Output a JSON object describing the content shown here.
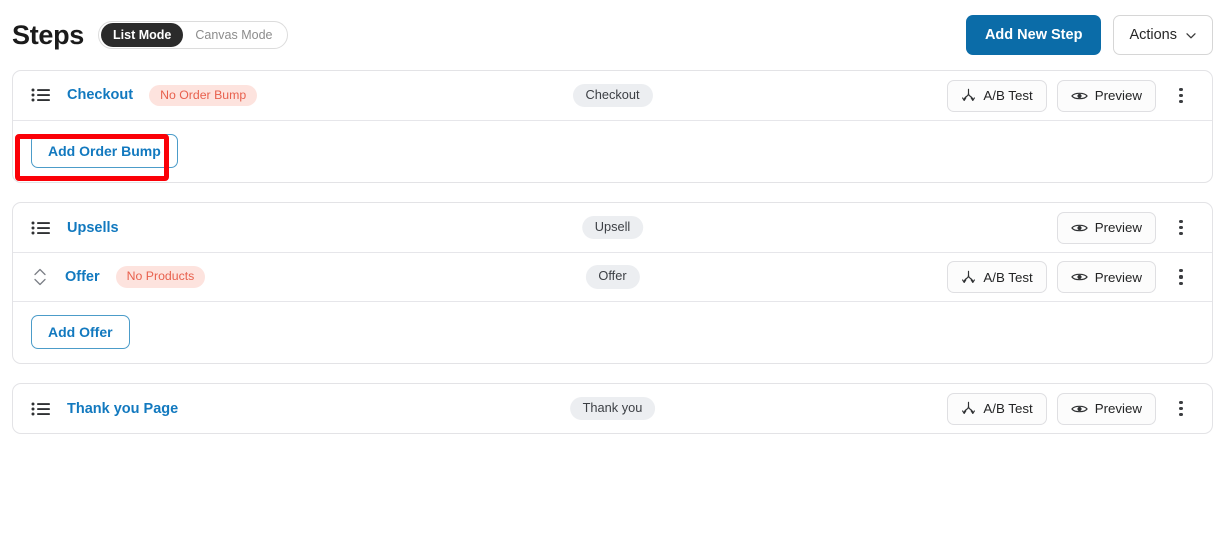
{
  "header": {
    "title": "Steps",
    "mode_toggle": {
      "active": "List Mode",
      "inactive": "Canvas Mode"
    },
    "add_new_step_label": "Add New Step",
    "actions_label": "Actions"
  },
  "labels": {
    "ab_test": "A/B Test",
    "preview": "Preview",
    "add_order_bump": "Add Order Bump",
    "add_offer": "Add Offer"
  },
  "steps": [
    {
      "name": "Checkout",
      "warning": "No Order Bump",
      "type_badge": "Checkout",
      "has_ab_test": true,
      "has_preview": true,
      "lead_icon": "list-icon",
      "footer_action": "Add Order Bump",
      "footer_highlighted": true
    },
    {
      "name": "Upsells",
      "warning": "",
      "type_badge": "Upsell",
      "has_ab_test": false,
      "has_preview": true,
      "lead_icon": "list-icon",
      "children": [
        {
          "name": "Offer",
          "warning": "No Products",
          "type_badge": "Offer",
          "has_ab_test": true,
          "has_preview": true,
          "lead_icon": "sort-updown-icon"
        }
      ],
      "footer_action": "Add Offer",
      "footer_highlighted": false
    },
    {
      "name": "Thank you Page",
      "warning": "",
      "type_badge": "Thank you",
      "has_ab_test": true,
      "has_preview": true,
      "lead_icon": "list-icon"
    }
  ],
  "colors": {
    "primary_blue": "#0b6ca8",
    "link_blue": "#1279bf",
    "warning_bg": "#fde3de",
    "warning_text": "#e8604d",
    "badge_bg": "#eceef1",
    "annotation_red": "#fb0007",
    "toggle_active_bg": "#2b2b2b"
  }
}
